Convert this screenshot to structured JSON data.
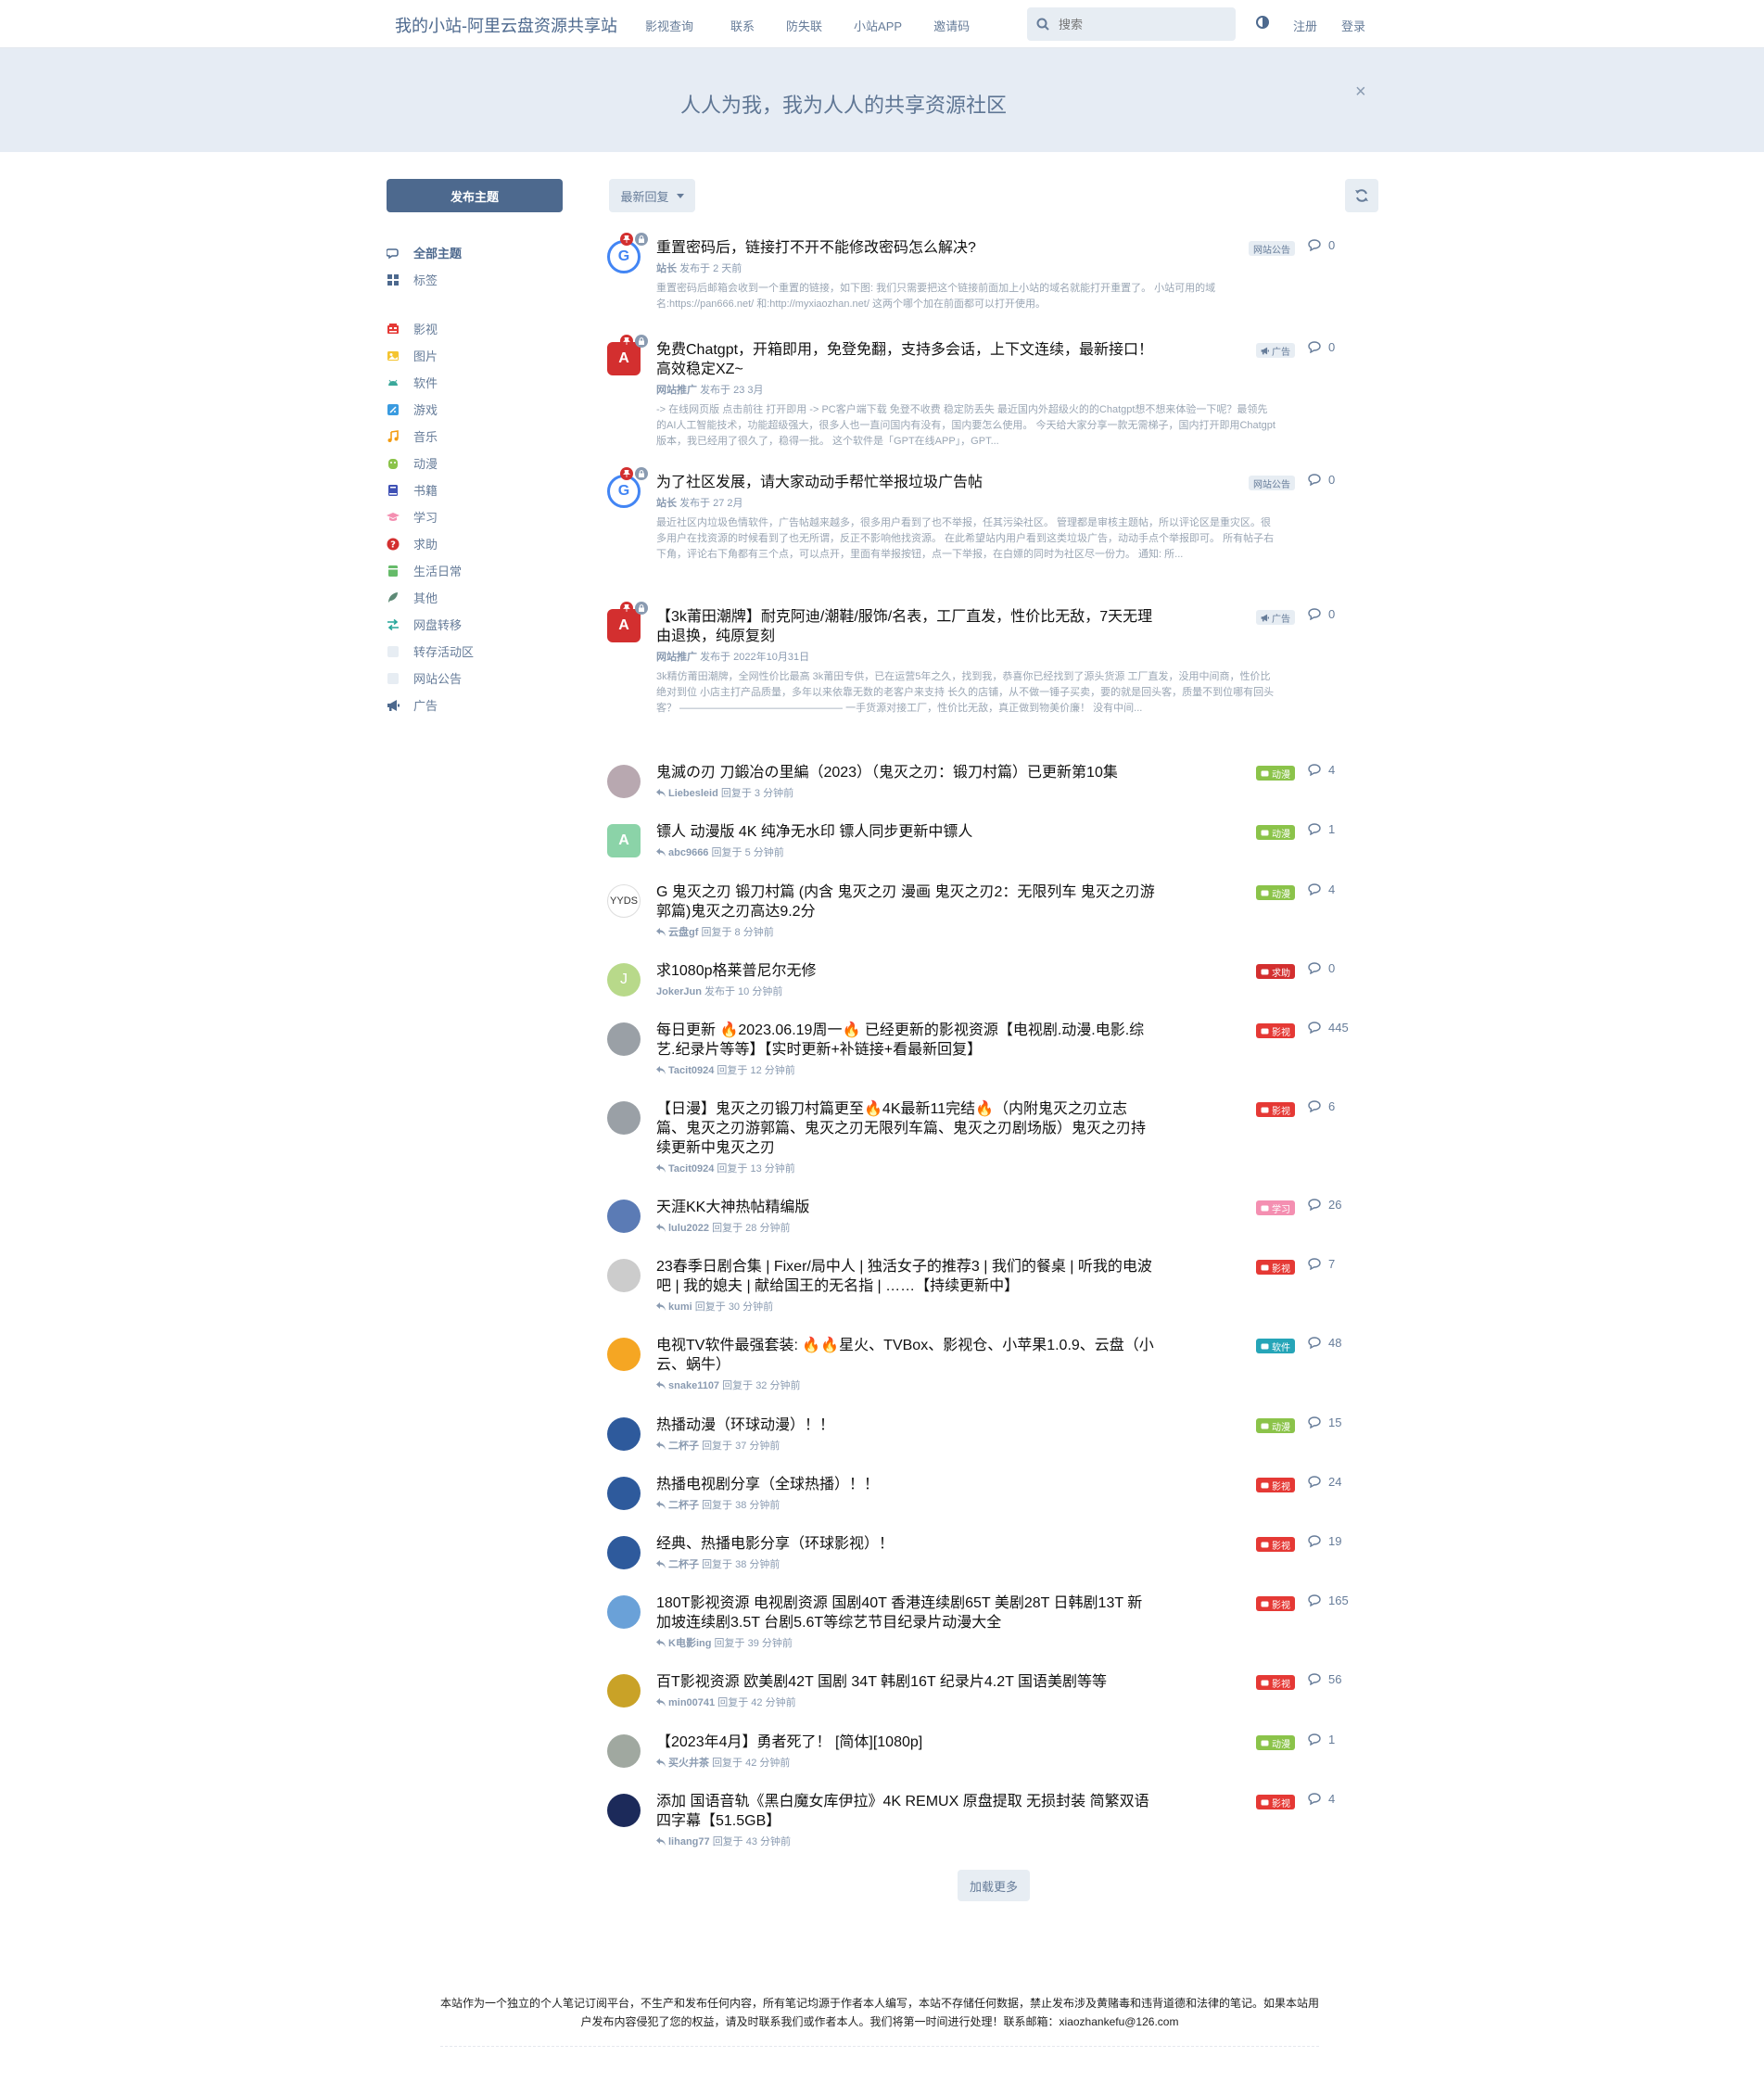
{
  "header": {
    "site_title": "我的小站-阿里云盘资源共享站",
    "nav": [
      "影视查询",
      "联系",
      "防失联",
      "小站APP",
      "邀请码"
    ],
    "search_placeholder": "搜索",
    "register": "注册",
    "login": "登录"
  },
  "hero": {
    "text": "人人为我，我为人人的共享资源社区",
    "close": "×"
  },
  "sidebar": {
    "post_button": "发布主题",
    "items": [
      {
        "label": "全部主题",
        "icon": "comments-icon",
        "color": "#4d698e"
      },
      {
        "label": "标签",
        "icon": "grid-icon",
        "color": "#4d698e"
      },
      {
        "label": "影视",
        "icon": "film-icon",
        "color": "#e53935"
      },
      {
        "label": "图片",
        "icon": "image-icon",
        "color": "#f4c430"
      },
      {
        "label": "软件",
        "icon": "android-icon",
        "color": "#3aa89a"
      },
      {
        "label": "游戏",
        "icon": "game-icon",
        "color": "#3a9be0"
      },
      {
        "label": "音乐",
        "icon": "music-icon",
        "color": "#f39c12"
      },
      {
        "label": "动漫",
        "icon": "anime-icon",
        "color": "#8bc34a"
      },
      {
        "label": "书籍",
        "icon": "book-icon",
        "color": "#3f51b5"
      },
      {
        "label": "学习",
        "icon": "graduation-icon",
        "color": "#f48fb1"
      },
      {
        "label": "求助",
        "icon": "question-icon",
        "color": "#d32f2f"
      },
      {
        "label": "生活日常",
        "icon": "life-icon",
        "color": "#66bb6a"
      },
      {
        "label": "其他",
        "icon": "feather-icon",
        "color": "#5d8a76"
      },
      {
        "label": "网盘转移",
        "icon": "transfer-icon",
        "color": "#26a69a"
      },
      {
        "label": "转存活动区",
        "icon": "blank-icon",
        "color": "#e7edf3"
      },
      {
        "label": "网站公告",
        "icon": "blank-icon",
        "color": "#e7edf3"
      },
      {
        "label": "广告",
        "icon": "bullhorn-icon",
        "color": "#4d698e"
      }
    ]
  },
  "toolbar": {
    "sort_label": "最新回复"
  },
  "discussions": [
    {
      "title": "重置密码后，链接打不开不能修改密码怎么解决?",
      "author": "站长",
      "action": "发布于",
      "time": "2 天前",
      "excerpt": "重置密码后邮箱会收到一个重置的链接，如下图: 我们只需要把这个链接前面加上小站的域名就能打开重置了。 小站可用的域名:https://pan666.net/ 和:http://myxiaozhan.net/ 这两个哪个加在前面都可以打开使用。",
      "tag": "网站公告",
      "tag_color": "#e7edf3",
      "tag_icon": "",
      "replies": "0",
      "avatar": "G",
      "avatar_color": "#4285f4",
      "pinned": true
    },
    {
      "title": "免费Chatgpt，开箱即用，免登免翻，支持多会话，上下文连续，最新接口！高效稳定XZ~",
      "author": "网站推广",
      "action": "发布于",
      "time": "23 3月",
      "excerpt": "-> 在线网页版 点击前往 打开即用 -> PC客户端下载 免登不收费 稳定防丢失 最近国内外超级火的的Chatgpt想不想来体验一下呢？最领先的AI人工智能技术，功能超级强大，很多人也一直问国内有没有，国内要怎么使用。 今天给大家分享一款无需梯子，国内打开即用Chatgpt版本，我已经用了很久了，稳得一批。 这个软件是「GPT在线APP」，GPT...",
      "tag": "广告",
      "tag_color": "#e7edf3",
      "tag_icon": "bullhorn-icon",
      "replies": "0",
      "avatar": "A",
      "avatar_color": "#d32f2f",
      "pinned": true
    },
    {
      "title": "为了社区发展，请大家动动手帮忙举报垃圾广告帖",
      "author": "站长",
      "action": "发布于",
      "time": "27 2月",
      "excerpt": "最近社区内垃圾色情软件，广告帖越来越多，很多用户看到了也不举报，任其污染社区。 管理都是审核主题帖，所以评论区是重灾区。很多用户在找资源的时候看到了也无所谓，反正不影响他找资源。 在此希望站内用户看到这类垃圾广告，动动手点个举报即可。 所有帖子右下角，评论右下角都有三个点，可以点开，里面有举报按钮，点一下举报，在白嫖的同时为社区尽一份力。 通知: 所...",
      "tag": "网站公告",
      "tag_color": "#e7edf3",
      "tag_icon": "",
      "replies": "0",
      "avatar": "G",
      "avatar_color": "#4285f4",
      "pinned": true
    },
    {
      "title": "【3k莆田潮牌】耐克阿迪/潮鞋/服饰/名表，工厂直发，性价比无敌，7天无理由退换，纯原复刻",
      "author": "网站推广",
      "action": "发布于",
      "time": "2022年10月31日",
      "excerpt": "3k精仿莆田潮牌，全网性价比最高 3k莆田专供，已在运营5年之久，找到我，恭喜你已经找到了源头货源 工厂直发，没用中间商，性价比绝对到位 小店主打产品质量，多年以来依靠无数的老客户来支持 长久的店铺，从不做一锤子买卖，要的就是回头客，质量不到位哪有回头客？ ———————————————— 一手货源对接工厂，性价比无敌，真正做到物美价廉！ 没有中间...",
      "tag": "广告",
      "tag_color": "#e7edf3",
      "tag_icon": "bullhorn-icon",
      "replies": "0",
      "avatar": "A",
      "avatar_color": "#d32f2f",
      "pinned": true
    },
    {
      "title": "鬼滅の刃 刀鍛冶の里編（2023）（鬼灭之刃：锻刀村篇）已更新第10集",
      "author": "Liebesleid",
      "action": "回复于",
      "time": "3 分钟前",
      "tag": "动漫",
      "tag_color": "#8bc34a",
      "replies": "4",
      "avatar": "",
      "avatar_color": "#b8a8b0"
    },
    {
      "title": "镖人 动漫版 4K 纯净无水印 镖人同步更新中镖人",
      "author": "abc9666",
      "action": "回复于",
      "time": "5 分钟前",
      "tag": "动漫",
      "tag_color": "#8bc34a",
      "replies": "1",
      "avatar": "A",
      "avatar_color": "#8bd3a8"
    },
    {
      "title": "G 鬼灭之刃 锻刀村篇 (内含 鬼灭之刃 漫画 鬼灭之刃2：无限列车 鬼灭之刃游郭篇)鬼灭之刃高达9.2分",
      "author": "云盘gf",
      "action": "回复于",
      "time": "8 分钟前",
      "tag": "动漫",
      "tag_color": "#8bc34a",
      "replies": "4",
      "avatar": "YYDS",
      "avatar_color": "#ffffff"
    },
    {
      "title": "求1080p格莱普尼尔无修",
      "author": "JokerJun",
      "action": "发布于",
      "time": "10 分钟前",
      "tag": "求助",
      "tag_color": "#d32f2f",
      "replies": "0",
      "avatar": "J",
      "avatar_color": "#b8d98a"
    },
    {
      "title": "每日更新 🔥2023.06.19周一🔥 已经更新的影视资源【电视剧.动漫.电影.综艺.纪录片等等】【实时更新+补链接+看最新回复】",
      "author": "Tacit0924",
      "action": "回复于",
      "time": "12 分钟前",
      "tag": "影视",
      "tag_color": "#e53935",
      "replies": "445",
      "avatar": "",
      "avatar_color": "#9aa0a6"
    },
    {
      "title": "【日漫】鬼灭之刃锻刀村篇更至🔥4K最新11完结🔥（内附鬼灭之刃立志篇、鬼灭之刃游郭篇、鬼灭之刃无限列车篇、鬼灭之刃剧场版）鬼灭之刃持续更新中鬼灭之刃",
      "author": "Tacit0924",
      "action": "回复于",
      "time": "13 分钟前",
      "tag": "影视",
      "tag_color": "#e53935",
      "replies": "6",
      "avatar": "",
      "avatar_color": "#9aa0a6"
    },
    {
      "title": "天涯KK大神热帖精编版",
      "author": "lulu2022",
      "action": "回复于",
      "time": "28 分钟前",
      "tag": "学习",
      "tag_color": "#f48fb1",
      "replies": "26",
      "avatar": "",
      "avatar_color": "#5b7bb5"
    },
    {
      "title": "23春季日剧合集 | Fixer/局中人 | 独活女子的推荐3 | 我们的餐桌 | 听我的电波吧 | 我的媳夫 | 献给国王的无名指 | ……【持续更新中】",
      "author": "kumi",
      "action": "回复于",
      "time": "30 分钟前",
      "tag": "影视",
      "tag_color": "#e53935",
      "replies": "7",
      "avatar": "",
      "avatar_color": "#cccccc"
    },
    {
      "title": "电视TV软件最强套装: 🔥🔥星火、TVBox、影视仓、小苹果1.0.9、云盘（小云、蜗牛）",
      "author": "snake1107",
      "action": "回复于",
      "time": "32 分钟前",
      "tag": "软件",
      "tag_color": "#26a5b8",
      "replies": "48",
      "avatar": "",
      "avatar_color": "#f5a623"
    },
    {
      "title": "热播动漫（环球动漫）！！",
      "author": "二杯子",
      "action": "回复于",
      "time": "37 分钟前",
      "tag": "动漫",
      "tag_color": "#8bc34a",
      "replies": "15",
      "avatar": "",
      "avatar_color": "#2e5a9c"
    },
    {
      "title": "热播电视剧分享（全球热播）！！",
      "author": "二杯子",
      "action": "回复于",
      "time": "38 分钟前",
      "tag": "影视",
      "tag_color": "#e53935",
      "replies": "24",
      "avatar": "",
      "avatar_color": "#2e5a9c"
    },
    {
      "title": "经典、热播电影分享（环球影视）！",
      "author": "二杯子",
      "action": "回复于",
      "time": "38 分钟前",
      "tag": "影视",
      "tag_color": "#e53935",
      "replies": "19",
      "avatar": "",
      "avatar_color": "#2e5a9c"
    },
    {
      "title": "180T影视资源 电视剧资源 国剧40T 香港连续剧65T 美剧28T 日韩剧13T 新加坡连续剧3.5T 台剧5.6T等综艺节目纪录片动漫大全",
      "author": "K电影ing",
      "action": "回复于",
      "time": "39 分钟前",
      "tag": "影视",
      "tag_color": "#e53935",
      "replies": "165",
      "avatar": "",
      "avatar_color": "#6aa1d8"
    },
    {
      "title": "百T影视资源 欧美剧42T 国剧 34T 韩剧16T 纪录片4.2T 国语美剧等等",
      "author": "min00741",
      "action": "回复于",
      "time": "42 分钟前",
      "tag": "影视",
      "tag_color": "#e53935",
      "replies": "56",
      "avatar": "",
      "avatar_color": "#c9a227"
    },
    {
      "title": "【2023年4月】勇者死了！ [简体][1080p]",
      "author": "买火井茶",
      "action": "回复于",
      "time": "42 分钟前",
      "tag": "动漫",
      "tag_color": "#8bc34a",
      "replies": "1",
      "avatar": "",
      "avatar_color": "#a0a8a0"
    },
    {
      "title": "添加 国语音轨《黑白魔女库伊拉》4K REMUX 原盘提取 无损封装 简繁双语四字幕【51.5GB】",
      "author": "lihang77",
      "action": "回复于",
      "time": "43 分钟前",
      "tag": "影视",
      "tag_color": "#e53935",
      "replies": "4",
      "avatar": "",
      "avatar_color": "#1c2a5a"
    }
  ],
  "load_more": "加载更多",
  "footer": {
    "text": "本站作为一个独立的个人笔记订阅平台，不生产和发布任何内容，所有笔记均源于作者本人编写，本站不存储任何数据，禁止发布涉及黄赌毒和违背道德和法律的笔记。如果本站用户发布内容侵犯了您的权益，请及时联系我们或作者本人。我们将第一时间进行处理！联系邮箱：xiaozhankefu@126.com"
  },
  "colors": {
    "primary": "#4d698e",
    "hero_bg": "#e6ecf4",
    "muted": "#667c99"
  }
}
